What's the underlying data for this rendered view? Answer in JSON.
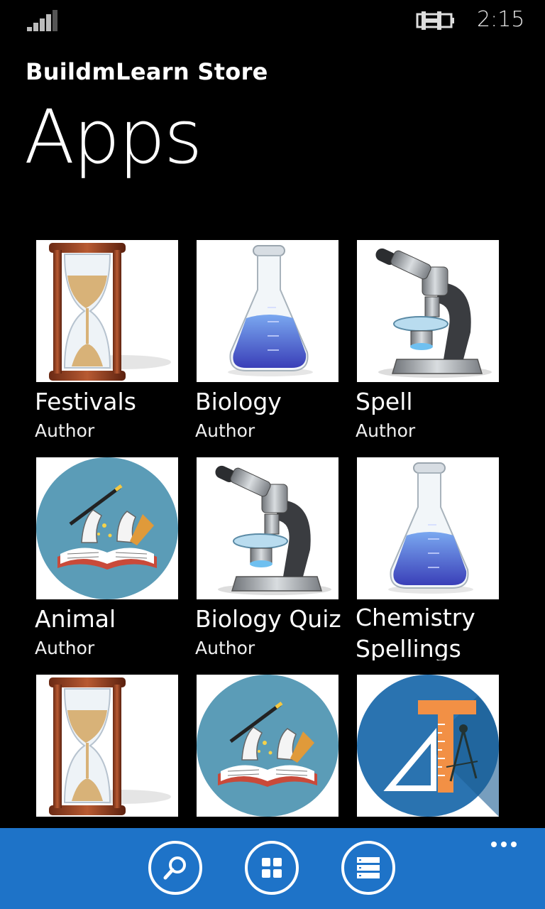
{
  "status": {
    "time": "2:15",
    "signal_icon": "signal-strength-icon",
    "battery_icon": "battery-charging-icon"
  },
  "header": {
    "app_title": "BuildmLearn Store",
    "page_title": "Apps"
  },
  "apps": [
    {
      "name": "Festivals",
      "author": "Author",
      "icon": "hourglass-icon"
    },
    {
      "name": "Biology",
      "author": "Author",
      "icon": "flask-icon"
    },
    {
      "name": "Spell",
      "author": "Author",
      "icon": "microscope-icon"
    },
    {
      "name": "Animal",
      "author": "Author",
      "icon": "book-magic-icon"
    },
    {
      "name": "Biology Quiz",
      "author": "Author",
      "icon": "microscope-icon"
    },
    {
      "name": "Chemistry Spellings",
      "author": "",
      "icon": "flask-icon"
    },
    {
      "name": "",
      "author": "",
      "icon": "hourglass-icon"
    },
    {
      "name": "",
      "author": "",
      "icon": "book-magic-icon"
    },
    {
      "name": "",
      "author": "",
      "icon": "ruler-compass-icon"
    }
  ],
  "app_bar": {
    "color": "#1e73c8",
    "buttons": [
      {
        "icon": "search-icon"
      },
      {
        "icon": "grid-icon"
      },
      {
        "icon": "list-icon"
      }
    ],
    "more_icon": "more-dots-icon"
  }
}
